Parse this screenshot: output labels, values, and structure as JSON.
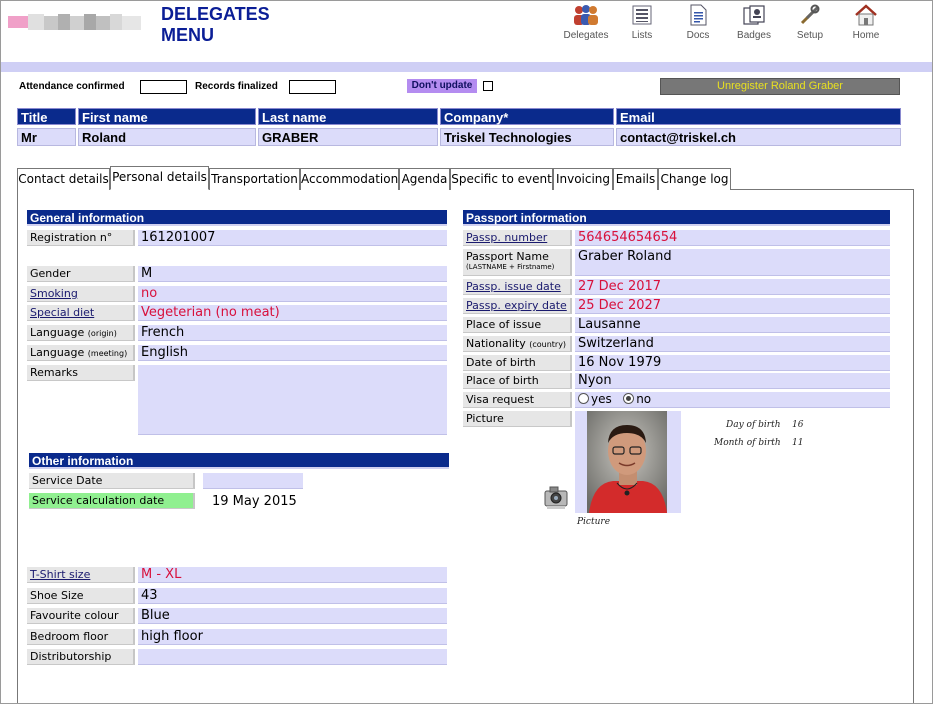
{
  "header": {
    "title_line1": "DELEGATES",
    "title_line2": "MENU",
    "nav": [
      {
        "label": "Delegates",
        "icon": "delegates-icon"
      },
      {
        "label": "Lists",
        "icon": "lists-icon"
      },
      {
        "label": "Docs",
        "icon": "docs-icon"
      },
      {
        "label": "Badges",
        "icon": "badges-icon"
      },
      {
        "label": "Setup",
        "icon": "setup-icon"
      },
      {
        "label": "Home",
        "icon": "home-icon"
      }
    ]
  },
  "status": {
    "attendance_label": "Attendance confirmed",
    "records_label": "Records finalized",
    "dont_update_label": "Don't update",
    "unregister_label": "Unregister Roland Graber"
  },
  "summary": {
    "headers": [
      "Title",
      "First name",
      "Last name",
      "Company*",
      "Email"
    ],
    "values": [
      "Mr",
      "Roland",
      "GRABER",
      "Triskel Technologies",
      "contact@triskel.ch"
    ]
  },
  "tabs": [
    "Contact details",
    "Personal details",
    "Transportation",
    "Accommodation",
    "Agenda",
    "Specific to event",
    "Invoicing",
    "Emails",
    "Change log"
  ],
  "active_tab": "Personal details",
  "general": {
    "title": "General information",
    "registration_label": "Registration n°",
    "registration_value": "161201007",
    "gender_label": "Gender",
    "gender_value": "M",
    "smoking_label": "Smoking",
    "smoking_value": "no",
    "diet_label": "Special diet",
    "diet_value": "Vegeterian (no meat)",
    "lang_origin_label": "Language",
    "lang_origin_sub": "(origin)",
    "lang_origin_value": "French",
    "lang_meeting_label": "Language",
    "lang_meeting_sub": "(meeting)",
    "lang_meeting_value": "English",
    "remarks_label": "Remarks",
    "remarks_value": ""
  },
  "other": {
    "title": "Other information",
    "service_date_label": "Service Date",
    "service_date_value": "",
    "service_calc_label": "Service calculation date",
    "service_calc_value": "19 May 2015"
  },
  "extras": {
    "tshirt_label": "T-Shirt size",
    "tshirt_value": "M - XL",
    "shoe_label": "Shoe Size",
    "shoe_value": "43",
    "colour_label": "Favourite colour",
    "colour_value": "Blue",
    "floor_label": "Bedroom floor",
    "floor_value": "high floor",
    "distrib_label": "Distributorship",
    "distrib_value": ""
  },
  "passport": {
    "title": "Passport information",
    "number_label": "Passp. number",
    "number_value": "564654654654",
    "name_label": "Passport Name",
    "name_sub": "(LASTNAME + Firstname)",
    "name_value": "Graber Roland",
    "issue_label": "Passp. issue date",
    "issue_value": "27 Dec 2017",
    "expiry_label": "Passp. expiry date",
    "expiry_value": "25 Dec 2027",
    "place_issue_label": "Place of issue",
    "place_issue_value": "Lausanne",
    "nationality_label": "Nationality",
    "nationality_sub": "(country)",
    "nationality_value": "Switzerland",
    "dob_label": "Date of birth",
    "dob_value": "16 Nov 1979",
    "pob_label": "Place of birth",
    "pob_value": "Nyon",
    "visa_label": "Visa request",
    "visa_yes": "yes",
    "visa_no": "no",
    "visa_selected": "no",
    "picture_label": "Picture",
    "picture_caption": "Picture",
    "day_of_birth_label": "Day of birth",
    "day_of_birth_value": "16",
    "month_of_birth_label": "Month of birth",
    "month_of_birth_value": "11"
  },
  "colors": {
    "header_blue": "#0a2a8c",
    "value_bg": "#dcdcfa",
    "red_text": "#d8103c",
    "green": "#90f090"
  }
}
